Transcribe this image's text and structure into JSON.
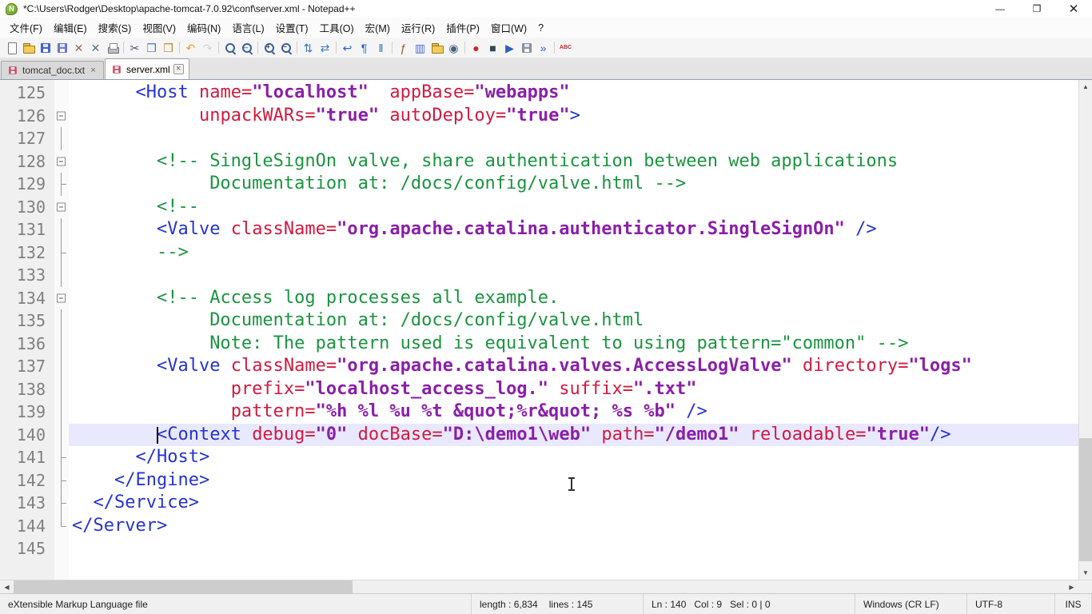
{
  "window": {
    "title": "*C:\\Users\\Rodger\\Desktop\\apache-tomcat-7.0.92\\conf\\server.xml - Notepad++",
    "controls": {
      "minimize": "—",
      "maximize": "❐",
      "close": "✕"
    }
  },
  "menu": {
    "items": [
      "文件(F)",
      "编辑(E)",
      "搜索(S)",
      "视图(V)",
      "编码(N)",
      "语言(L)",
      "设置(T)",
      "工具(O)",
      "宏(M)",
      "运行(R)",
      "插件(P)",
      "窗口(W)",
      "?"
    ]
  },
  "toolbar": {
    "items": [
      {
        "name": "new-file-button",
        "kind": "page"
      },
      {
        "name": "open-file-button",
        "kind": "folder"
      },
      {
        "name": "save-file-button",
        "kind": "floppy",
        "color": "#3f64c9"
      },
      {
        "name": "save-all-button",
        "kind": "floppy",
        "color": "#6b78c9"
      },
      {
        "name": "close-file-button",
        "kind": "glyph",
        "glyph": "✕",
        "color": "#8a6d5c"
      },
      {
        "name": "close-all-button",
        "kind": "glyph",
        "glyph": "✕",
        "color": "#5c6d8a"
      },
      {
        "name": "print-button",
        "kind": "printer"
      },
      {
        "kind": "sep"
      },
      {
        "name": "cut-button",
        "kind": "glyph",
        "glyph": "✂",
        "color": "#4a5a78"
      },
      {
        "name": "copy-button",
        "kind": "glyph",
        "glyph": "❐",
        "color": "#4a6fd4"
      },
      {
        "name": "paste-button",
        "kind": "glyph",
        "glyph": "❒",
        "color": "#b8862d"
      },
      {
        "kind": "sep"
      },
      {
        "name": "undo-button",
        "kind": "glyph",
        "glyph": "↶",
        "color": "#e8a020"
      },
      {
        "name": "redo-button",
        "kind": "glyph",
        "glyph": "↷",
        "color": "#9aa4ae",
        "disabled": true
      },
      {
        "kind": "sep"
      },
      {
        "name": "find-button",
        "kind": "mag"
      },
      {
        "name": "replace-button",
        "kind": "mag",
        "glyph": "↔"
      },
      {
        "kind": "sep"
      },
      {
        "name": "zoom-in-button",
        "kind": "mag",
        "glyph": "+"
      },
      {
        "name": "zoom-out-button",
        "kind": "mag",
        "glyph": "−"
      },
      {
        "kind": "sep"
      },
      {
        "name": "sync-vertical-scroll-button",
        "kind": "glyph",
        "glyph": "⇅",
        "color": "#3a7ac0"
      },
      {
        "name": "sync-horizontal-scroll-button",
        "kind": "glyph",
        "glyph": "⇄",
        "color": "#3a7ac0"
      },
      {
        "kind": "sep"
      },
      {
        "name": "word-wrap-button",
        "kind": "glyph",
        "glyph": "↩",
        "color": "#2a62c8"
      },
      {
        "name": "show-all-characters-button",
        "kind": "glyph",
        "glyph": "¶",
        "color": "#2a62c8"
      },
      {
        "name": "indent-guide-button",
        "kind": "glyph",
        "glyph": "‖",
        "color": "#2a62c8"
      },
      {
        "kind": "sep"
      },
      {
        "name": "function-list-button",
        "kind": "glyph",
        "glyph": "ƒ",
        "color": "#8a5a28"
      },
      {
        "name": "document-map-button",
        "kind": "glyph",
        "glyph": "▥",
        "color": "#4a6fd4"
      },
      {
        "name": "folder-as-workspace-button",
        "kind": "folder"
      },
      {
        "name": "document-monitoring-button",
        "kind": "glyph",
        "glyph": "◉",
        "color": "#44617e"
      },
      {
        "kind": "sep"
      },
      {
        "name": "record-macro-button",
        "kind": "glyph",
        "glyph": "●",
        "color": "#c62828"
      },
      {
        "name": "stop-macro-button",
        "kind": "glyph",
        "glyph": "■",
        "color": "#36474f"
      },
      {
        "name": "play-macro-button",
        "kind": "glyph",
        "glyph": "▶",
        "color": "#2e5fb8"
      },
      {
        "name": "save-macro-button",
        "kind": "floppy",
        "color": "#8a8f98"
      },
      {
        "name": "run-macro-multiple-button",
        "kind": "glyph",
        "glyph": "»",
        "color": "#2e5fb8"
      },
      {
        "kind": "sep"
      },
      {
        "name": "spell-check-button",
        "kind": "glyph",
        "glyph": "ABC",
        "color": "#b03030"
      }
    ]
  },
  "tabs": [
    {
      "label": "tomcat_doc.txt",
      "active": false,
      "modified": true
    },
    {
      "label": "server.xml",
      "active": true,
      "modified": true
    }
  ],
  "ui": {
    "tab_close": "×",
    "scroll_up": "▲",
    "scroll_down": "▼",
    "scroll_left": "◀",
    "scroll_right": "▶"
  },
  "editor": {
    "current_line": 140,
    "caret": {
      "line": 140,
      "col": 9
    },
    "colors": {
      "tag": "#2633ce",
      "attribute": "#ce1b40",
      "value": "#8a1fa8",
      "comment": "#1b9440",
      "line_number": "#808080",
      "current_line_bg": "#e8e8ff"
    },
    "lines": [
      {
        "num": 125,
        "fold": null,
        "seg": [
          [
            "p",
            "      "
          ],
          [
            "t",
            "<Host"
          ],
          [
            "p",
            " "
          ],
          [
            "a",
            "name="
          ],
          [
            "v",
            "\"localhost\""
          ],
          [
            "p",
            "  "
          ],
          [
            "a",
            "appBase="
          ],
          [
            "v",
            "\"webapps\""
          ]
        ]
      },
      {
        "num": 126,
        "fold": "box",
        "seg": [
          [
            "p",
            "            "
          ],
          [
            "a",
            "unpackWARs="
          ],
          [
            "v",
            "\"true\""
          ],
          [
            "p",
            " "
          ],
          [
            "a",
            "autoDeploy="
          ],
          [
            "v",
            "\"true\""
          ],
          [
            "t",
            ">"
          ]
        ]
      },
      {
        "num": 127,
        "fold": "vline",
        "seg": []
      },
      {
        "num": 128,
        "fold": "box",
        "seg": [
          [
            "p",
            "        "
          ],
          [
            "c",
            "<!-- SingleSignOn valve, share authentication between web applications"
          ]
        ]
      },
      {
        "num": 129,
        "fold": "tee",
        "seg": [
          [
            "p",
            "             "
          ],
          [
            "c",
            "Documentation at: /docs/config/valve.html -->"
          ]
        ]
      },
      {
        "num": 130,
        "fold": "box",
        "seg": [
          [
            "p",
            "        "
          ],
          [
            "c",
            "<!--"
          ]
        ]
      },
      {
        "num": 131,
        "fold": "vline",
        "seg": [
          [
            "p",
            "        "
          ],
          [
            "t",
            "<Valve"
          ],
          [
            "p",
            " "
          ],
          [
            "a",
            "className="
          ],
          [
            "v",
            "\"org.apache.catalina.authenticator.SingleSignOn\""
          ],
          [
            "p",
            " "
          ],
          [
            "t",
            "/>"
          ]
        ]
      },
      {
        "num": 132,
        "fold": "tee",
        "seg": [
          [
            "p",
            "        "
          ],
          [
            "c",
            "-->"
          ]
        ]
      },
      {
        "num": 133,
        "fold": "vline",
        "seg": []
      },
      {
        "num": 134,
        "fold": "box",
        "seg": [
          [
            "p",
            "        "
          ],
          [
            "c",
            "<!-- Access log processes all example."
          ]
        ]
      },
      {
        "num": 135,
        "fold": "vline",
        "seg": [
          [
            "p",
            "             "
          ],
          [
            "c",
            "Documentation at: /docs/config/valve.html"
          ]
        ]
      },
      {
        "num": 136,
        "fold": "vline",
        "seg": [
          [
            "p",
            "             "
          ],
          [
            "c",
            "Note: The pattern used is equivalent to using pattern=\"common\" -->"
          ]
        ]
      },
      {
        "num": 137,
        "fold": "vline",
        "seg": [
          [
            "p",
            "        "
          ],
          [
            "t",
            "<Valve"
          ],
          [
            "p",
            " "
          ],
          [
            "a",
            "className="
          ],
          [
            "v",
            "\"org.apache.catalina.valves.AccessLogValve\""
          ],
          [
            "p",
            " "
          ],
          [
            "a",
            "directory="
          ],
          [
            "v",
            "\"logs\""
          ]
        ]
      },
      {
        "num": 138,
        "fold": "vline",
        "seg": [
          [
            "p",
            "               "
          ],
          [
            "a",
            "prefix="
          ],
          [
            "v",
            "\"localhost_access_log.\""
          ],
          [
            "p",
            " "
          ],
          [
            "a",
            "suffix="
          ],
          [
            "v",
            "\".txt\""
          ]
        ]
      },
      {
        "num": 139,
        "fold": "vline",
        "seg": [
          [
            "p",
            "               "
          ],
          [
            "a",
            "pattern="
          ],
          [
            "v",
            "\"%h %l %u %t &quot;%r&quot; %s %b\""
          ],
          [
            "p",
            " "
          ],
          [
            "t",
            "/>"
          ]
        ]
      },
      {
        "num": 140,
        "fold": "vline",
        "seg": [
          [
            "p",
            "        "
          ],
          [
            "t",
            "<Context"
          ],
          [
            "p",
            " "
          ],
          [
            "a",
            "debug="
          ],
          [
            "v",
            "\"0\""
          ],
          [
            "p",
            " "
          ],
          [
            "a",
            "docBase="
          ],
          [
            "v",
            "\"D:\\demo1\\web\""
          ],
          [
            "p",
            " "
          ],
          [
            "a",
            "path="
          ],
          [
            "v",
            "\"/demo1\""
          ],
          [
            "p",
            " "
          ],
          [
            "a",
            "reloadable="
          ],
          [
            "v",
            "\"true\""
          ],
          [
            "t",
            "/>"
          ]
        ]
      },
      {
        "num": 141,
        "fold": "tee",
        "seg": [
          [
            "p",
            "      "
          ],
          [
            "t",
            "</Host>"
          ]
        ]
      },
      {
        "num": 142,
        "fold": "tee",
        "seg": [
          [
            "p",
            "    "
          ],
          [
            "t",
            "</Engine>"
          ]
        ]
      },
      {
        "num": 143,
        "fold": "tee",
        "seg": [
          [
            "p",
            "  "
          ],
          [
            "t",
            "</Service>"
          ]
        ]
      },
      {
        "num": 144,
        "fold": "corner",
        "seg": [
          [
            "t",
            "</Server>"
          ]
        ]
      },
      {
        "num": 145,
        "fold": null,
        "seg": []
      }
    ]
  },
  "status": {
    "doc_type": "eXtensible Markup Language file",
    "length_label": "length : 6,834",
    "lines_label": "lines : 145",
    "position": "Ln : 140   Col : 9   Sel : 0 | 0",
    "eol": "Windows (CR LF)",
    "encoding": "UTF-8",
    "mode": "INS"
  }
}
